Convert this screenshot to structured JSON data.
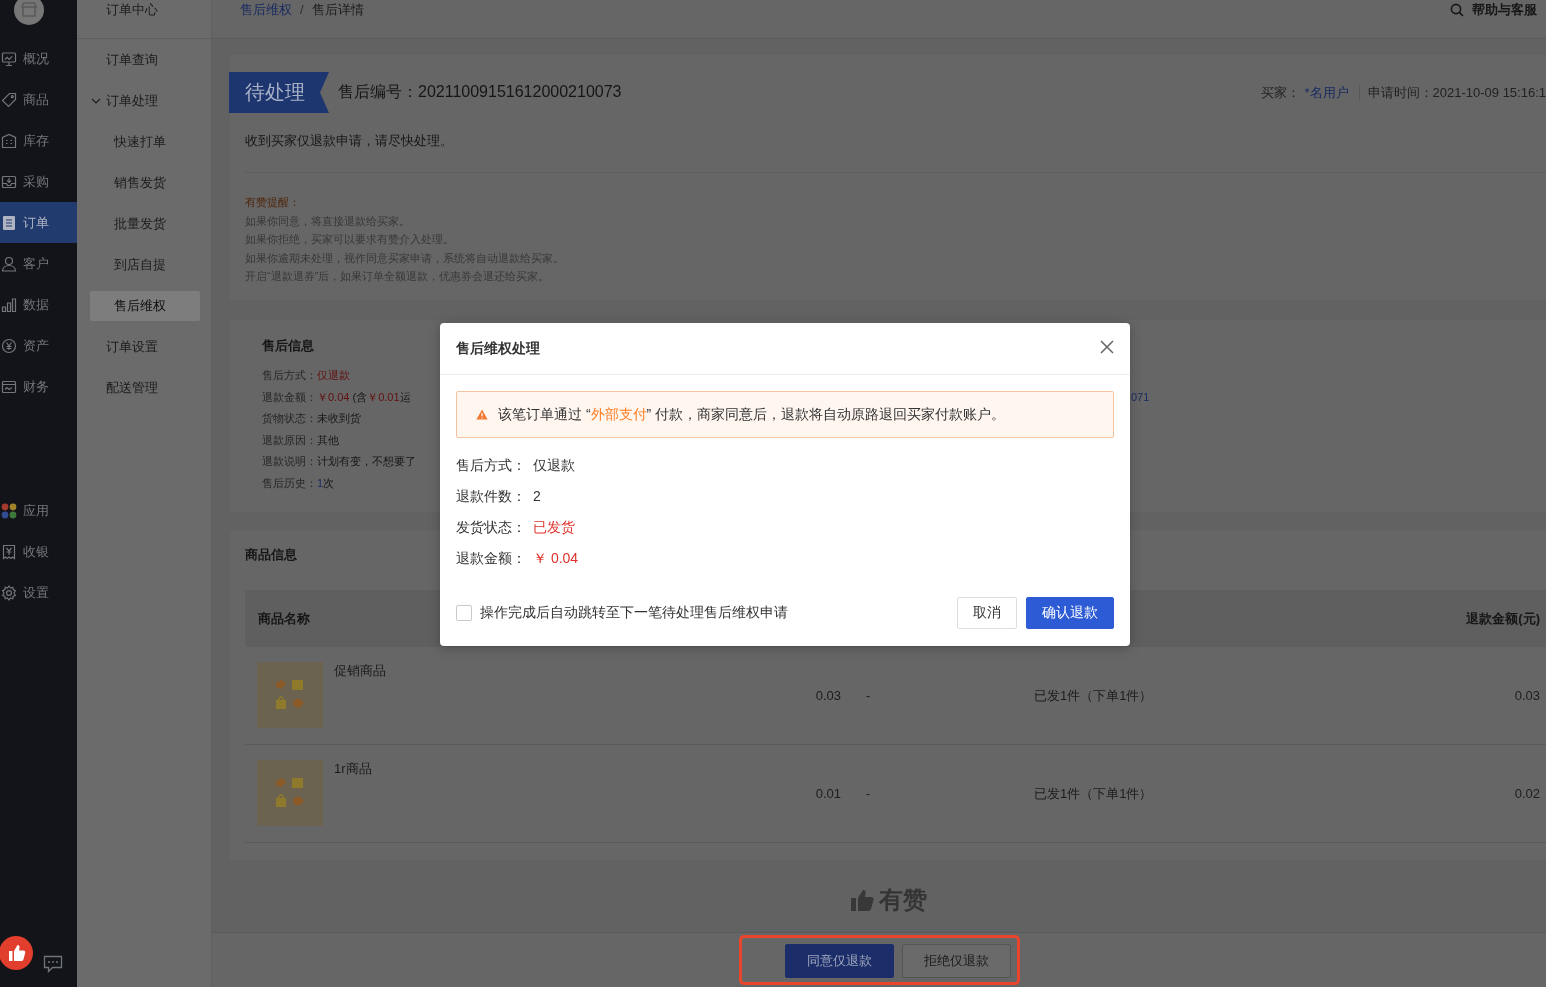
{
  "nav_rail": {
    "items": [
      {
        "label": "概况",
        "selected": false
      },
      {
        "label": "商品",
        "selected": false
      },
      {
        "label": "库存",
        "selected": false
      },
      {
        "label": "采购",
        "selected": false
      },
      {
        "label": "订单",
        "selected": true
      },
      {
        "label": "客户",
        "selected": false
      },
      {
        "label": "数据",
        "selected": false
      },
      {
        "label": "资产",
        "selected": false
      },
      {
        "label": "财务",
        "selected": false
      }
    ],
    "lower_items": [
      {
        "label": "应用",
        "selected": false
      },
      {
        "label": "收银",
        "selected": false
      },
      {
        "label": "设置",
        "selected": false
      }
    ]
  },
  "menu": {
    "title": "订单中心",
    "items": [
      {
        "label": "订单查询",
        "selected": false
      },
      {
        "label": "订单处理",
        "selected": false,
        "expanded": true,
        "children": [
          {
            "label": "快速打单",
            "selected": false
          },
          {
            "label": "销售发货",
            "selected": false
          },
          {
            "label": "批量发货",
            "selected": false
          },
          {
            "label": "到店自提",
            "selected": false
          },
          {
            "label": "售后维权",
            "selected": true
          }
        ]
      },
      {
        "label": "订单设置",
        "selected": false
      },
      {
        "label": "配送管理",
        "selected": false
      }
    ]
  },
  "top_bar": {
    "breadcrumb": {
      "separator": "/",
      "items": [
        {
          "label": "售后维权",
          "kind": "link"
        },
        {
          "label": "售后详情",
          "kind": "current"
        }
      ]
    },
    "help": "帮助与客服"
  },
  "summary": {
    "status": "待处理",
    "number": "售后编号：20211009151612000210073",
    "buyer_label": "买家：",
    "buyer": "*名用户",
    "applied_at": "申请时间：2021-10-09 15:16:1",
    "message": "收到买家仅退款申请，请尽快处理。",
    "tips_title": "有赞提醒：",
    "tips": [
      "如果你同意，将直接退款给买家。",
      "如果你拒绝，买家可以要求有赞介入处理。",
      "如果你逾期未处理，视作同意买家申请，系统将自动退款给买家。",
      "开启“退款退券”后，如果订单全额退款，优惠券会退还给买家。"
    ]
  },
  "after_sale_info": {
    "title": "售后信息",
    "rows": [
      {
        "label": "售后方式：",
        "parts": [
          {
            "text": "仅退款",
            "kind": "alert"
          }
        ]
      },
      {
        "label": "退款金额：",
        "parts": [
          {
            "text": "￥0.04",
            "kind": "alert"
          },
          {
            "text": " (含",
            "kind": "plain"
          },
          {
            "text": "￥0.01",
            "kind": "alert"
          },
          {
            "text": "运",
            "kind": "plain"
          }
        ]
      },
      {
        "label": "货物状态：",
        "parts": [
          {
            "text": "未收到货",
            "kind": "plain"
          }
        ]
      },
      {
        "label": "退款原因：",
        "parts": [
          {
            "text": "其他",
            "kind": "plain"
          }
        ]
      },
      {
        "label": "退款说明：",
        "parts": [
          {
            "text": "计划有变，不想要了",
            "kind": "plain"
          }
        ]
      },
      {
        "label": "售后历史：",
        "parts": [
          {
            "text": "1",
            "kind": "link"
          },
          {
            "text": "次",
            "kind": "plain"
          }
        ]
      }
    ],
    "column_2": "071"
  },
  "goods": {
    "title": "商品信息",
    "name_header": "商品名称",
    "refund_header": "退款金额(元)",
    "rows": [
      {
        "name": "促销商品",
        "column_2": "0.03",
        "column_3": "-",
        "column_4": "已发1件（下单1件）",
        "refund": "0.03"
      },
      {
        "name": "1r商品",
        "column_2": "0.01",
        "column_3": "-",
        "column_4": "已发1件（下单1件）",
        "refund": "0.02"
      }
    ]
  },
  "brand": "有赞",
  "actions": [
    {
      "label": "同意仅退款",
      "kind": "primary"
    },
    {
      "label": "拒绝仅退款",
      "kind": "default"
    }
  ],
  "dialog": {
    "title": "售后维权处理",
    "alert": [
      {
        "text": "该笔订单通过 “",
        "kind": "plain"
      },
      {
        "text": "外部支付",
        "kind": "accent"
      },
      {
        "text": "” 付款，商家同意后，退款将自动原路退回买家付款账户。",
        "kind": "plain"
      }
    ],
    "fields": [
      {
        "label": "售后方式：",
        "value": "仅退款",
        "kind": "plain"
      },
      {
        "label": "退款件数：",
        "value": "2",
        "kind": "plain"
      },
      {
        "label": "发货状态：",
        "value": "已发货",
        "kind": "alert"
      },
      {
        "label": "退款金额：",
        "value": "￥ 0.04",
        "kind": "alert"
      }
    ],
    "auto_next": {
      "label": "操作完成后自动跳转至下一笔待处理售后维权申请",
      "checked": false
    },
    "buttons": [
      {
        "label": "取消",
        "kind": "default"
      },
      {
        "label": "确认退款",
        "kind": "primary"
      }
    ]
  }
}
